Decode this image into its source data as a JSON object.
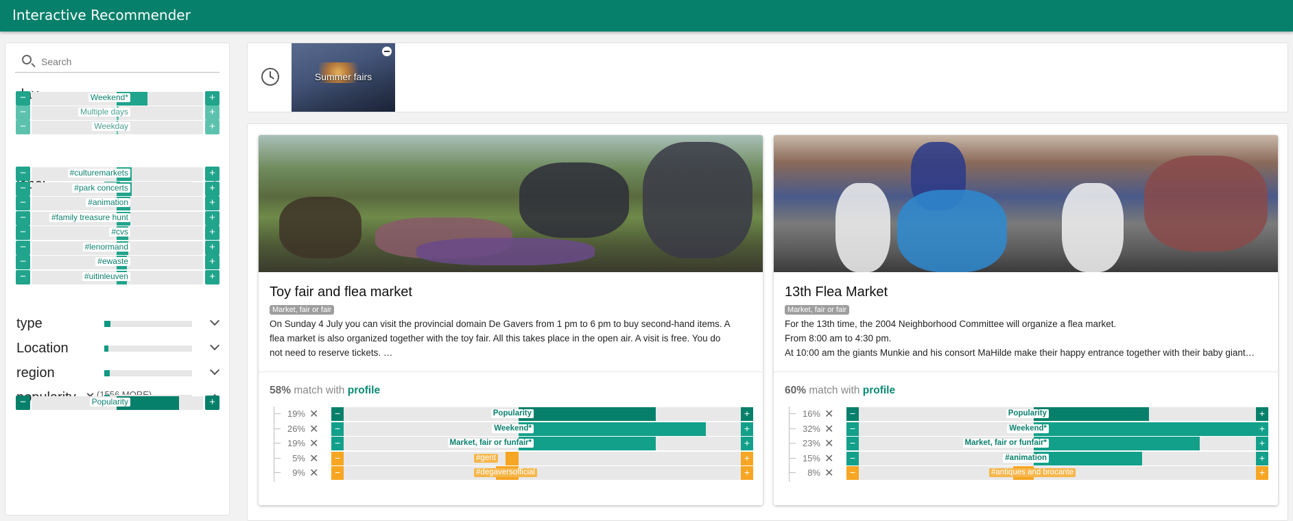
{
  "app": {
    "title": "Interactive Recommender"
  },
  "search": {
    "placeholder": "Search"
  },
  "facets": {
    "day": {
      "name": "day",
      "level": 0.58,
      "expanded": true,
      "items": [
        {
          "label": "Weekend*",
          "value": 0.35
        },
        {
          "label": "Multiple days",
          "value": 0.02
        },
        {
          "label": "Weekday",
          "value": 0.01
        }
      ]
    },
    "label": {
      "name": "label",
      "level": 0.18,
      "expanded": true,
      "items": [
        {
          "label": "#culturemarkets",
          "value": 0.17
        },
        {
          "label": "#park concerts",
          "value": 0.17
        },
        {
          "label": "#animation",
          "value": 0.16
        },
        {
          "label": "#family treasure hunt",
          "value": 0.16
        },
        {
          "label": "#cvs",
          "value": 0.13
        },
        {
          "label": "#lenormand",
          "value": 0.13
        },
        {
          "label": "#ewaste",
          "value": 0.12
        },
        {
          "label": "#uitinleuven",
          "value": 0.12
        }
      ],
      "more": "(1556 MORE)"
    },
    "type": {
      "name": "type",
      "level": 0.07,
      "expanded": false
    },
    "location": {
      "name": "Location",
      "level": 0.05,
      "expanded": false
    },
    "region": {
      "name": "region",
      "level": 0.06,
      "expanded": false
    },
    "popularity": {
      "name": "popularity",
      "level": 0.06,
      "expanded": true,
      "items": [
        {
          "label": "Popularity",
          "value": 0.71
        }
      ]
    }
  },
  "history": {
    "items": [
      {
        "label": "Summer fairs"
      }
    ]
  },
  "cards": [
    {
      "title": "Toy fair and flea market",
      "tag": "Market, fair or fair",
      "desc": [
        "On Sunday 4 July you can visit the provincial domain De Gavers from 1 pm to 6 pm to buy second-hand items. A",
        "flea market is also organized together with the toy fair. All this takes place in the open air. A visit is free. You do",
        "not need to reserve tickets.                                             …"
      ],
      "match_pct": "58%",
      "match_text": "match with",
      "match_profile": "profile",
      "rows": [
        {
          "pct": "19%",
          "label": "Popularity",
          "value": 0.19,
          "tone": "dark"
        },
        {
          "pct": "26%",
          "label": "Weekend*",
          "value": 0.26,
          "tone": "mid"
        },
        {
          "pct": "19%",
          "label": "Market, fair or funfair*",
          "value": 0.19,
          "tone": "mid"
        },
        {
          "pct": "5%",
          "label": "#gent",
          "value": -0.05,
          "tone": "neg"
        },
        {
          "pct": "9%",
          "label": "#degaversofficial",
          "value": -0.09,
          "tone": "neg"
        }
      ]
    },
    {
      "title": "13th Flea Market",
      "tag": "Market, fair or fair",
      "desc": [
        "For the 13th time, the 2004 Neighborhood Committee will organize a flea market.",
        "From 8:00 am to 4:30 pm.",
        "At 10:00 am the giants Munkie and his consort MaHilde make their happy entrance together with their baby giant…"
      ],
      "match_pct": "60%",
      "match_text": "match with",
      "match_profile": "profile",
      "rows": [
        {
          "pct": "16%",
          "label": "Popularity",
          "value": 0.16,
          "tone": "dark"
        },
        {
          "pct": "32%",
          "label": "Weekend*",
          "value": 0.32,
          "tone": "mid"
        },
        {
          "pct": "23%",
          "label": "Market, fair or funfair*",
          "value": 0.23,
          "tone": "mid"
        },
        {
          "pct": "15%",
          "label": "#animation",
          "value": 0.15,
          "tone": "mid"
        },
        {
          "pct": "8%",
          "label": "#antiques and brocante",
          "value": -0.08,
          "tone": "neg"
        }
      ]
    }
  ],
  "colors": {
    "primary": "#07806b",
    "accent": "#12a08a",
    "negative": "#f6a623"
  }
}
